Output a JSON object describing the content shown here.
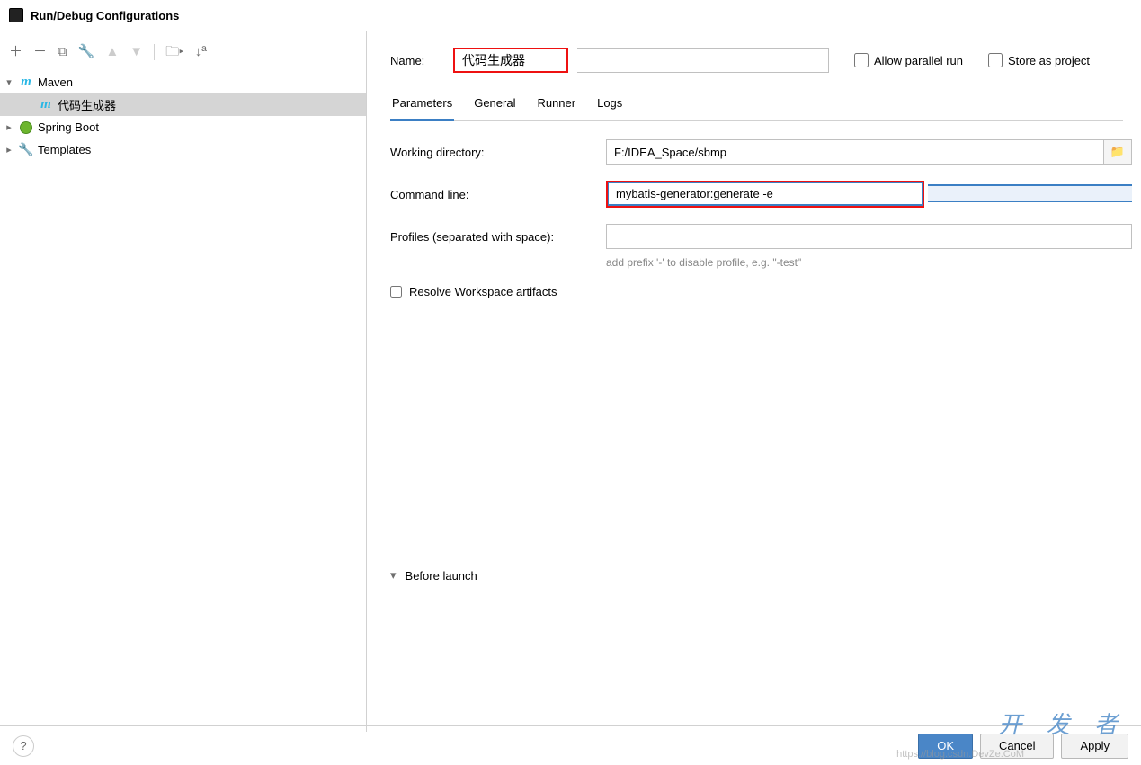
{
  "title": "Run/Debug Configurations",
  "tree": {
    "maven": "Maven",
    "maven_child": "代码生成器",
    "spring": "Spring Boot",
    "templates": "Templates"
  },
  "form": {
    "name_label": "Name:",
    "name_value": "代码生成器",
    "allow_parallel": "Allow parallel run",
    "store_project": "Store as project",
    "tabs": {
      "parameters": "Parameters",
      "general": "General",
      "runner": "Runner",
      "logs": "Logs"
    },
    "wd_label": "Working directory:",
    "wd_value": "F:/IDEA_Space/sbmp",
    "cmd_label": "Command line:",
    "cmd_value": "mybatis-generator:generate -e",
    "prof_label": "Profiles (separated with space):",
    "prof_value": "",
    "prof_hint": "add prefix '-' to disable profile, e.g. \"-test\"",
    "resolve": "Resolve Workspace artifacts",
    "before": "Before launch"
  },
  "footer": {
    "ok": "OK",
    "cancel": "Cancel",
    "apply": "Apply"
  },
  "watermark": "开 发 者",
  "watermark2": "https://blog.csdn.DevZe.CoM"
}
